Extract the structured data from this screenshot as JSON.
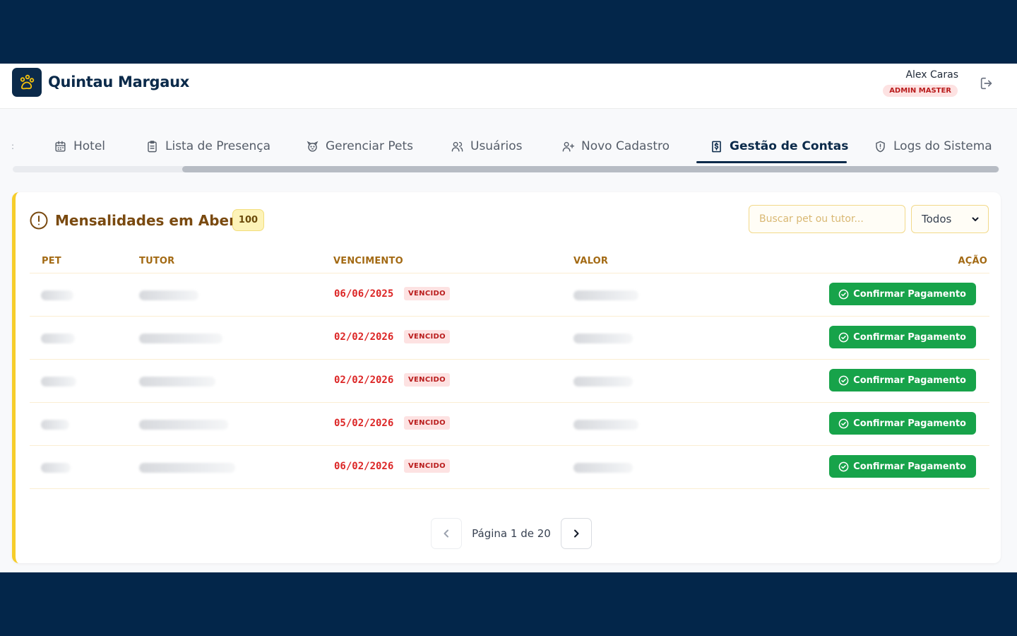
{
  "header": {
    "brand": "Quintau Margaux",
    "user_name": "Alex Caras",
    "user_role": "ADMIN MASTER",
    "logo_icon": "paw-icon",
    "logout_icon": "logout-icon"
  },
  "tabs": [
    {
      "label": "Hotel",
      "icon": "calendar-icon",
      "active": false
    },
    {
      "label": "Lista de Presença",
      "icon": "clipboard-icon",
      "active": false
    },
    {
      "label": "Gerenciar Pets",
      "icon": "dog-icon",
      "active": false
    },
    {
      "label": "Usuários",
      "icon": "users-icon",
      "active": false
    },
    {
      "label": "Novo Cadastro",
      "icon": "user-plus-icon",
      "active": false
    },
    {
      "label": "Gestão de Contas",
      "icon": "receipt-dollar-icon",
      "active": true
    },
    {
      "label": "Logs do Sistema",
      "icon": "shield-icon",
      "active": false
    }
  ],
  "card": {
    "title": "Mensalidades em Aberto",
    "count": "100",
    "search_placeholder": "Buscar pet ou tutor...",
    "filter_value": "Todos"
  },
  "table": {
    "columns": [
      "PET",
      "TUTOR",
      "VENCIMENTO",
      "VALOR",
      "AÇÃO"
    ],
    "rows": [
      {
        "due_date": "06/06/2025",
        "status": "VENCIDO",
        "action": "Confirmar Pagamento"
      },
      {
        "due_date": "02/02/2026",
        "status": "VENCIDO",
        "action": "Confirmar Pagamento"
      },
      {
        "due_date": "02/02/2026",
        "status": "VENCIDO",
        "action": "Confirmar Pagamento"
      },
      {
        "due_date": "05/02/2026",
        "status": "VENCIDO",
        "action": "Confirmar Pagamento"
      },
      {
        "due_date": "06/02/2026",
        "status": "VENCIDO",
        "action": "Confirmar Pagamento"
      }
    ]
  },
  "pagination": {
    "text": "Página 1 de 20"
  },
  "colors": {
    "navy": "#0b2a4a",
    "accent_yellow": "#f6cd2a",
    "success_green": "#17a34a",
    "danger_red": "#dc2626"
  }
}
